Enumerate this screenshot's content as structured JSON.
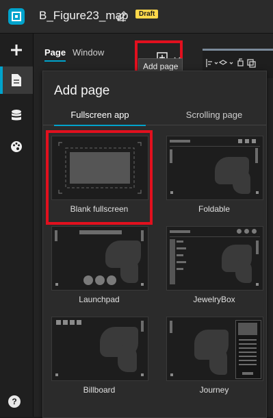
{
  "app": {
    "title": "B_Figure23_map",
    "status_badge": "Draft"
  },
  "panel": {
    "tabs": [
      {
        "label": "Page"
      },
      {
        "label": "Window"
      }
    ],
    "add_page_tooltip": "Add page"
  },
  "add_page_menu": {
    "title": "Add page",
    "tabs": [
      {
        "label": "Fullscreen app"
      },
      {
        "label": "Scrolling page"
      }
    ],
    "templates": [
      {
        "label": "Blank fullscreen"
      },
      {
        "label": "Foldable"
      },
      {
        "label": "Launchpad"
      },
      {
        "label": "JewelryBox"
      },
      {
        "label": "Billboard"
      },
      {
        "label": "Journey"
      }
    ]
  },
  "rail": {
    "help_label": "?"
  },
  "colors": {
    "accent": "#00a3cc",
    "highlight": "#e1101e",
    "draft_badge": "#ffd84a"
  }
}
